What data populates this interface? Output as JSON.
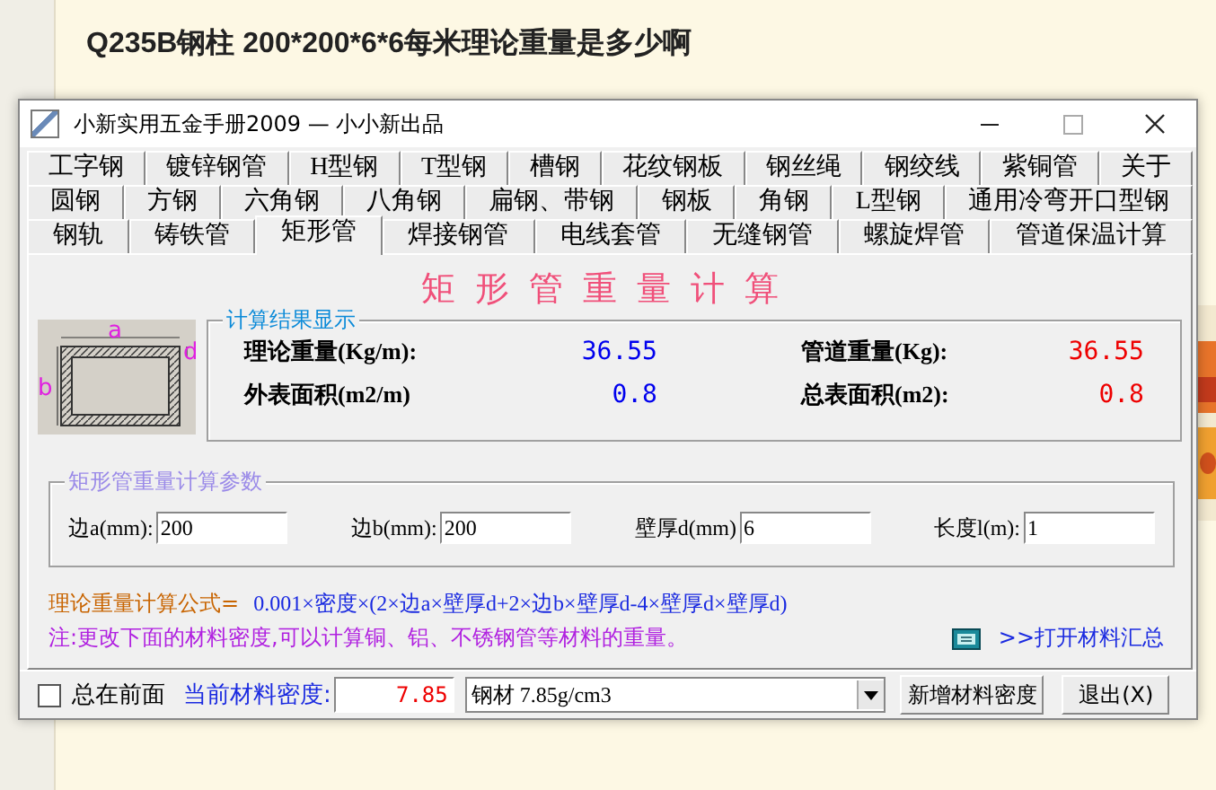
{
  "page": {
    "question": "Q235B钢柱 200*200*6*6每米理论重量是多少啊"
  },
  "window": {
    "title": "小新实用五金手册2009 — 小小新出品"
  },
  "tab_rows": [
    {
      "tabs": [
        {
          "label": "工字钢",
          "selected": false
        },
        {
          "label": "镀锌钢管",
          "selected": false
        },
        {
          "label": "H型钢",
          "selected": false
        },
        {
          "label": "T型钢",
          "selected": false
        },
        {
          "label": "槽钢",
          "selected": false
        },
        {
          "label": "花纹钢板",
          "selected": false
        },
        {
          "label": "钢丝绳",
          "selected": false
        },
        {
          "label": "钢绞线",
          "selected": false
        },
        {
          "label": "紫铜管",
          "selected": false
        },
        {
          "label": "关于",
          "selected": false
        }
      ]
    },
    {
      "tabs": [
        {
          "label": "圆钢",
          "selected": false
        },
        {
          "label": "方钢",
          "selected": false
        },
        {
          "label": "六角钢",
          "selected": false
        },
        {
          "label": "八角钢",
          "selected": false
        },
        {
          "label": "扁钢、带钢",
          "selected": false
        },
        {
          "label": "钢板",
          "selected": false
        },
        {
          "label": "角钢",
          "selected": false
        },
        {
          "label": "L型钢",
          "selected": false
        },
        {
          "label": "通用冷弯开口型钢",
          "selected": false
        }
      ]
    },
    {
      "tabs": [
        {
          "label": "钢轨",
          "selected": false
        },
        {
          "label": "铸铁管",
          "selected": false
        },
        {
          "label": "矩形管",
          "selected": true
        },
        {
          "label": "焊接钢管",
          "selected": false
        },
        {
          "label": "电线套管",
          "selected": false
        },
        {
          "label": "无缝钢管",
          "selected": false
        },
        {
          "label": "螺旋焊管",
          "selected": false
        },
        {
          "label": "管道保温计算",
          "selected": false
        }
      ]
    }
  ],
  "heading": "矩形管重量计算",
  "diagram": {
    "labels": [
      "a",
      "b",
      "d"
    ]
  },
  "results": {
    "legend": "计算结果显示",
    "rows": [
      {
        "label_1": "理论重量(Kg/m):",
        "value_1": "36.55",
        "label_2": "管道重量(Kg):",
        "value_2": "36.55"
      },
      {
        "label_1": "外表面积(m2/m)",
        "value_1": "0.8",
        "label_2": "总表面积(m2):",
        "value_2": "0.8"
      }
    ]
  },
  "params": {
    "legend": "矩形管重量计算参数",
    "fields": [
      {
        "label": "边a(mm):",
        "value": "200"
      },
      {
        "label": "边b(mm):",
        "value": "200"
      },
      {
        "label": "壁厚d(mm)",
        "value": "6"
      },
      {
        "label": "长度l(m):",
        "value": "1"
      }
    ]
  },
  "formula": {
    "label": "理论重量计算公式=",
    "text": "0.001×密度×(2×边a×壁厚d+2×边b×壁厚d-4×壁厚d×壁厚d)"
  },
  "note": "注:更改下面的材料密度,可以计算铜、铝、不锈钢管等材料的重量。",
  "link": ">>打开材料汇总",
  "bottom": {
    "always_on_top": {
      "label": "总在前面",
      "checked": false
    },
    "density_label": "当前材料密度:",
    "density": "7.85",
    "material": "钢材 7.85g/cm3",
    "buttons": [
      "新增材料密度",
      "退出(X)"
    ]
  }
}
